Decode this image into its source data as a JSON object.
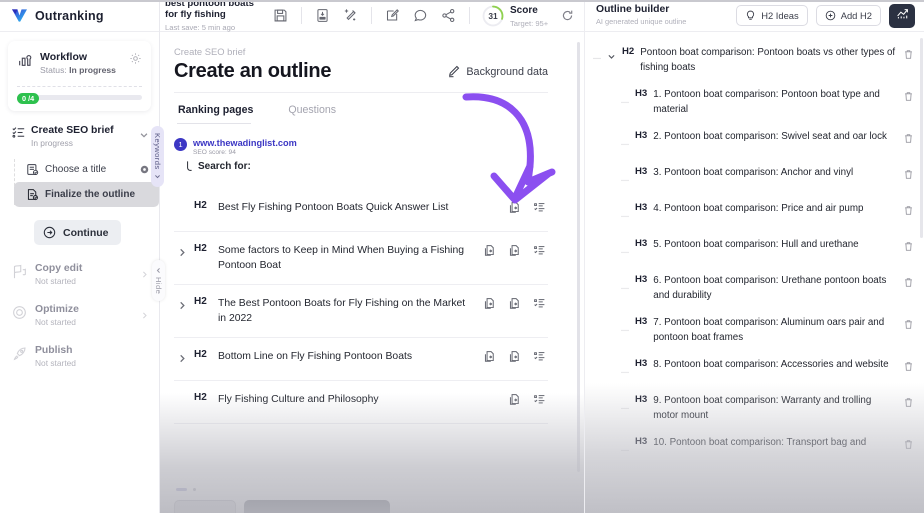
{
  "brand": {
    "name": "Outranking"
  },
  "sidebar": {
    "workflow": {
      "title": "Workflow",
      "status_label": "Status:",
      "status_value": "In progress",
      "progress_badge": "0 /4"
    },
    "step": {
      "title": "Create SEO brief",
      "subtitle": "In progress",
      "substeps": [
        {
          "label": "Choose a title",
          "active": false
        },
        {
          "label": "Finalize the outline",
          "active": true
        }
      ],
      "continue_label": "Continue"
    },
    "stages": [
      {
        "title": "Copy edit",
        "sub": "Not started"
      },
      {
        "title": "Optimize",
        "sub": "Not started"
      },
      {
        "title": "Publish",
        "sub": "Not started"
      }
    ],
    "vertical_tabs": {
      "keywords": "Keywords",
      "hide": "Hide"
    }
  },
  "topbar": {
    "doc_title": "best pontoon boats for fly fishing",
    "last_save": "Last save: 5 min ago",
    "icons": [
      "save-icon",
      "export-doc-icon",
      "ai-wand-icon",
      "edit-note-icon",
      "comment-icon",
      "share-icon"
    ],
    "score": {
      "value": "31",
      "label": "Score",
      "target": "Target: 95+",
      "percent": 31
    }
  },
  "editor": {
    "breadcrumb": "Create SEO brief",
    "title": "Create an outline",
    "background_data_label": "Background data",
    "tabs": [
      {
        "label": "Ranking pages",
        "active": true
      },
      {
        "label": "Questions",
        "active": false
      }
    ],
    "ranking_page": {
      "rank": "1",
      "url": "www.thewadinglist.com",
      "seo_score": "SEO score: 94",
      "search_for_label": "Search for:"
    },
    "outline_items": [
      {
        "tag": "H2",
        "text": "Best Fly Fishing Pontoon Boats Quick Answer List",
        "expandable": false,
        "extra_action": false
      },
      {
        "tag": "H2",
        "text": "Some factors to Keep in Mind When Buying a Fishing Pontoon Boat",
        "expandable": true,
        "extra_action": true
      },
      {
        "tag": "H2",
        "text": "The Best Pontoon Boats for Fly Fishing on the Market in 2022",
        "expandable": true,
        "extra_action": true
      },
      {
        "tag": "H2",
        "text": "Bottom Line on Fly Fishing Pontoon Boats",
        "expandable": true,
        "extra_action": true
      },
      {
        "tag": "H2",
        "text": "Fly Fishing Culture and Philosophy",
        "expandable": false,
        "extra_action": false
      }
    ]
  },
  "outline_builder": {
    "title": "Outline builder",
    "subtitle": "AI generated unique outline",
    "h2_ideas_label": "H2 Ideas",
    "add_h2_label": "Add H2",
    "items": [
      {
        "tag": "H2",
        "text": "Pontoon boat comparison: Pontoon boats vs other types of fishing boats"
      },
      {
        "tag": "H3",
        "text": "1. Pontoon boat comparison: Pontoon boat type and material"
      },
      {
        "tag": "H3",
        "text": "2. Pontoon boat comparison: Swivel seat and oar lock"
      },
      {
        "tag": "H3",
        "text": "3. Pontoon boat comparison: Anchor and vinyl"
      },
      {
        "tag": "H3",
        "text": "4. Pontoon boat comparison: Price and air pump"
      },
      {
        "tag": "H3",
        "text": "5. Pontoon boat comparison: Hull and urethane"
      },
      {
        "tag": "H3",
        "text": "6. Pontoon boat comparison: Urethane pontoon boats and durability"
      },
      {
        "tag": "H3",
        "text": "7. Pontoon boat comparison: Aluminum oars pair and pontoon boat frames"
      },
      {
        "tag": "H3",
        "text": "8. Pontoon boat comparison: Accessories and website"
      },
      {
        "tag": "H3",
        "text": "9. Pontoon boat comparison: Warranty and trolling motor mount"
      },
      {
        "tag": "H3",
        "text": "10. Pontoon boat comparison: Transport bag and"
      }
    ]
  },
  "colors": {
    "accent_purple": "#8b4ff0",
    "brand_blue": "#3c37c4",
    "dark_navy": "#2b3142",
    "green": "#2ec14e",
    "score_ring": "#8fd14f"
  }
}
